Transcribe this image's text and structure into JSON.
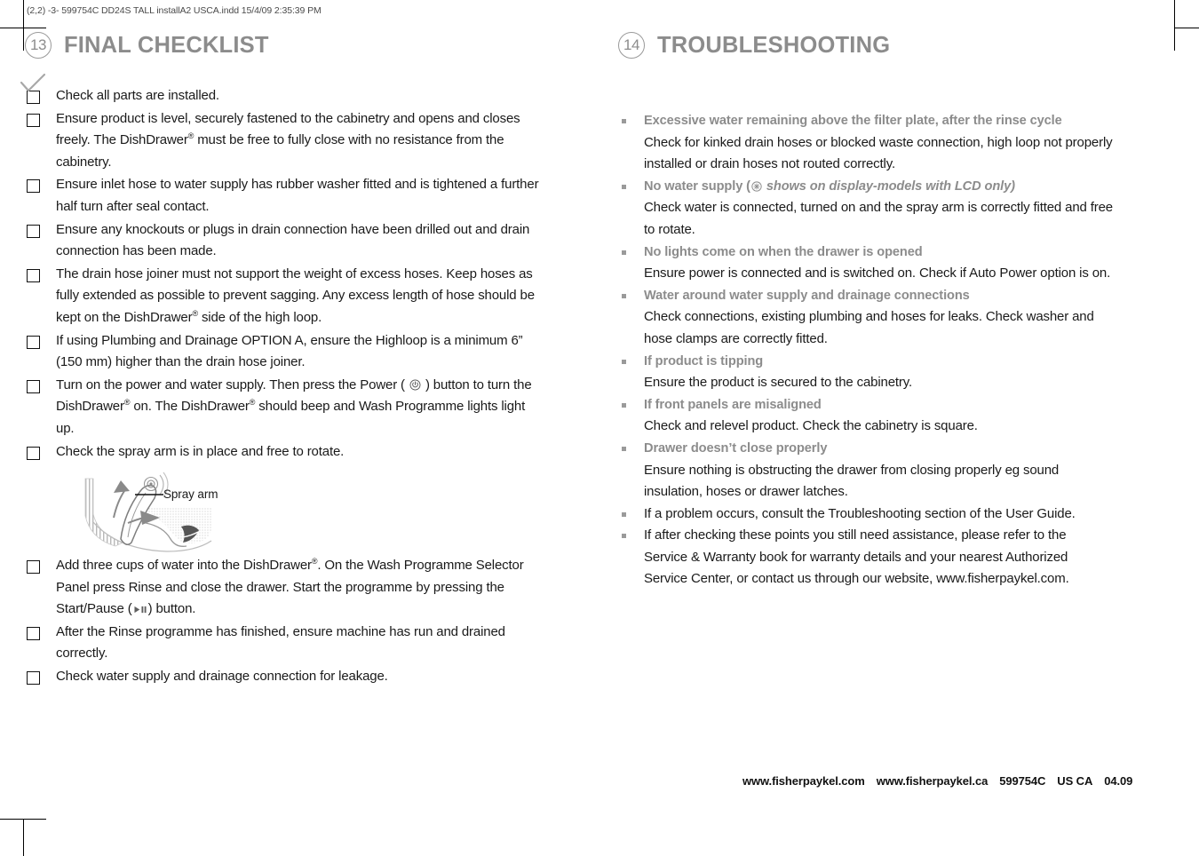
{
  "slug": "(2,2)  -3- 599754C DD24S TALL installA2 USCA.indd 15/4/09 2:35:39 PM",
  "colors": {
    "heading_gray": "#8c8c8c",
    "bullet_gray": "#9a9a9a",
    "body_black": "#1a1a1a"
  },
  "left_column": {
    "section": {
      "number": "13",
      "title": "FINAL CHECKLIST"
    },
    "tick_icon": "check-mark-icon",
    "checklist": [
      {
        "text": "Check all parts are installed."
      },
      {
        "text": "Ensure product is level, securely fastened to the cabinetry and opens and closes freely. The DishDrawer® must be free to fully close with no resistance from the cabinetry."
      },
      {
        "text": "Ensure inlet hose to water supply has rubber washer fitted and is tightened a further half turn after seal contact."
      },
      {
        "text": "Ensure any knockouts or plugs in drain connection have been drilled out and drain connection has been made."
      },
      {
        "text": "The drain hose joiner must not support the weight of excess hoses. Keep hoses as fully extended as possible to prevent sagging. Any excess length of hose should be kept on the DishDrawer® side of the high loop."
      },
      {
        "text": "If using Plumbing and Drainage OPTION A, ensure the Highloop is a minimum 6” (150 mm) higher than the drain hose joiner."
      },
      {
        "text_before": "Turn on the power and water supply. Then press the Power ( ",
        "icon": "power-icon",
        "text_after": " ) button to turn the DishDrawer® on. The DishDrawer® should beep and Wash Programme lights light up."
      },
      {
        "text": "Check the spray arm is in place and free to rotate."
      }
    ],
    "figure": {
      "label": "Spray arm",
      "name": "spray-arm-diagram"
    },
    "checklist_after_figure": [
      {
        "text_before": "Add three cups of water into the DishDrawer®. On the Wash Programme Selector Panel press Rinse and close the drawer. Start the programme by pressing the Start/Pause (",
        "icon": "start-pause-icon",
        "text_after": ") button."
      },
      {
        "text": "After the Rinse programme has finished, ensure machine has run and drained correctly."
      },
      {
        "text": "Check water supply and drainage connection for leakage."
      }
    ]
  },
  "right_column": {
    "section": {
      "number": "14",
      "title": "TROUBLESHOOTING"
    },
    "items": [
      {
        "heading": "Excessive water remaining above the filter plate, after the rinse cycle",
        "body": "Check for kinked drain hoses or blocked waste connection, high loop not properly installed or drain hoses not routed correctly."
      },
      {
        "heading_before": "No water supply (",
        "heading_icon": "no-water-tap-icon",
        "heading_note": " shows on display-models with LCD only)",
        "body": "Check water is connected, turned on and the spray arm is correctly fitted and free to rotate."
      },
      {
        "heading": "No lights come on when the drawer is opened",
        "body": "Ensure power is connected and is switched on. Check if Auto Power option is on."
      },
      {
        "heading": "Water around water supply and drainage connections",
        "body": "Check connections, existing plumbing and hoses for leaks. Check washer and hose clamps are correctly fitted."
      },
      {
        "heading": "If product is tipping",
        "body": "Ensure the product is secured to the cabinetry."
      },
      {
        "heading": "If front panels are misaligned",
        "body": "Check and relevel product. Check the cabinetry is square."
      },
      {
        "heading": "Drawer doesn’t close properly",
        "body": "Ensure nothing is obstructing the drawer from closing properly eg sound insulation, hoses or drawer latches."
      }
    ],
    "plain_items": [
      "If a problem occurs, consult the Troubleshooting section of the User Guide.",
      "If after checking these points you still need assistance, please refer to the Service & Warranty book for warranty details and your nearest Authorized Service Center, or contact us through our website, www.fisherpaykel.com."
    ]
  },
  "footer": {
    "site_com": "www.fisherpaykel.com",
    "site_ca": "www.fisherpaykel.ca",
    "doc_code": "599754C",
    "region": "US CA",
    "date": "04.09"
  }
}
